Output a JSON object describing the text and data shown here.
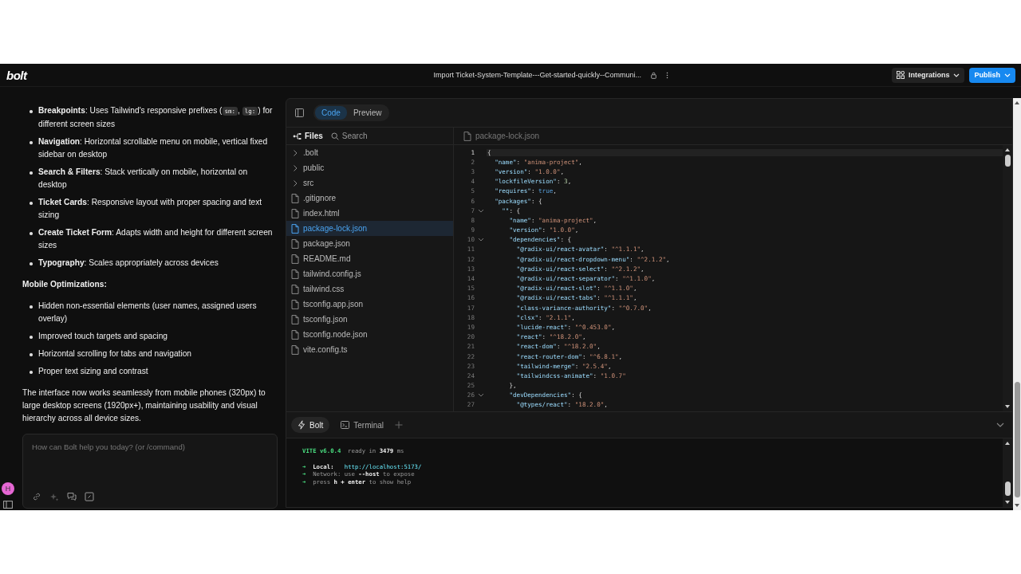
{
  "header": {
    "logo": "bolt",
    "title": "Import Ticket-System-Template---Get-started-quickly--Communi...",
    "buttons": [
      {
        "label": "Integrations",
        "kind": "secondary"
      },
      {
        "label": "Publish",
        "kind": "primary"
      }
    ]
  },
  "chat": {
    "sections": [
      {
        "kind": "list",
        "items": [
          [
            {
              "kind": "text",
              "text": "**Breakpoints**: Uses Tailwind's responsive prefixes ("
            },
            {
              "kind": "code",
              "text": "sm:"
            },
            {
              "kind": "text",
              "text": ", "
            },
            {
              "kind": "code",
              "text": "lg:"
            },
            {
              "kind": "text",
              "text": ") for different screen sizes"
            }
          ],
          [
            {
              "kind": "text",
              "text": "**Navigation**: Horizontal scrollable menu on mobile, vertical fixed sidebar on desktop"
            }
          ],
          [
            {
              "kind": "text",
              "text": "**Search & Filters**: Stack vertically on mobile, horizontal on desktop"
            }
          ],
          [
            {
              "kind": "text",
              "text": "**Ticket Cards**: Responsive layout with proper spacing and text sizing"
            }
          ],
          [
            {
              "kind": "text",
              "text": "**Create Ticket Form**: Adapts width and height for different screen sizes"
            }
          ],
          [
            {
              "kind": "text",
              "text": "**Typography**: Scales appropriately across devices"
            }
          ]
        ]
      },
      {
        "kind": "heading",
        "text": "Mobile Optimizations:"
      },
      {
        "kind": "list",
        "items": [
          [
            {
              "kind": "text",
              "text": "Hidden non-essential elements (user names, assigned users overlay)"
            }
          ],
          [
            {
              "kind": "text",
              "text": "Improved touch targets and spacing"
            }
          ],
          [
            {
              "kind": "text",
              "text": "Horizontal scrolling for tabs and navigation"
            }
          ],
          [
            {
              "kind": "text",
              "text": "Proper text sizing and contrast"
            }
          ]
        ]
      },
      {
        "kind": "paragraph",
        "text": "The interface now works seamlessly from mobile phones (320px) to large desktop screens (1920px+), maintaining usability and visual hierarchy across all device sizes."
      }
    ],
    "input": {
      "placeholder": "How can Bolt help you today? (or /command)"
    },
    "avatar": "H"
  },
  "view_tabs": [
    {
      "label": "Code",
      "selected": true
    },
    {
      "label": "Preview",
      "selected": false
    }
  ],
  "file_panel": {
    "tabs": [
      {
        "label": "Files",
        "kind": "files",
        "selected": true
      },
      {
        "label": "Search",
        "kind": "search",
        "selected": false
      }
    ],
    "files": [
      {
        "name": ".bolt",
        "kind": "folder",
        "expanded": false,
        "selected": false
      },
      {
        "name": "public",
        "kind": "folder",
        "expanded": false,
        "selected": false
      },
      {
        "name": "src",
        "kind": "folder",
        "expanded": false,
        "selected": false
      },
      {
        "name": ".gitignore",
        "kind": "file",
        "selected": false
      },
      {
        "name": "index.html",
        "kind": "file",
        "selected": false
      },
      {
        "name": "package-lock.json",
        "kind": "file",
        "selected": true
      },
      {
        "name": "package.json",
        "kind": "file",
        "selected": false
      },
      {
        "name": "README.md",
        "kind": "file",
        "selected": false
      },
      {
        "name": "tailwind.config.js",
        "kind": "file",
        "selected": false
      },
      {
        "name": "tailwind.css",
        "kind": "file",
        "selected": false
      },
      {
        "name": "tsconfig.app.json",
        "kind": "file",
        "selected": false
      },
      {
        "name": "tsconfig.json",
        "kind": "file",
        "selected": false
      },
      {
        "name": "tsconfig.node.json",
        "kind": "file",
        "selected": false
      },
      {
        "name": "vite.config.ts",
        "kind": "file",
        "selected": false
      }
    ]
  },
  "editor": {
    "tab": "package-lock.json",
    "lines": [
      {
        "number": "1",
        "text": "{",
        "fold": false,
        "selected": true
      },
      {
        "number": "2",
        "text": "  \"name\": \"anima-project\",",
        "fold": false,
        "selected": false
      },
      {
        "number": "3",
        "text": "  \"version\": \"1.0.0\",",
        "fold": false,
        "selected": false
      },
      {
        "number": "4",
        "text": "  \"lockfileVersion\": 3,",
        "fold": false,
        "selected": false
      },
      {
        "number": "5",
        "text": "  \"requires\": true,",
        "fold": false,
        "selected": false
      },
      {
        "number": "6",
        "text": "  \"packages\": {",
        "fold": false,
        "selected": false
      },
      {
        "number": "7",
        "text": "    \"\": {",
        "fold": true,
        "selected": false
      },
      {
        "number": "8",
        "text": "      \"name\": \"anima-project\",",
        "fold": false,
        "selected": false
      },
      {
        "number": "9",
        "text": "      \"version\": \"1.0.0\",",
        "fold": false,
        "selected": false
      },
      {
        "number": "10",
        "text": "      \"dependencies\": {",
        "fold": true,
        "selected": false
      },
      {
        "number": "11",
        "text": "        \"@radix-ui/react-avatar\": \"^1.1.1\",",
        "fold": false,
        "selected": false
      },
      {
        "number": "12",
        "text": "        \"@radix-ui/react-dropdown-menu\": \"^2.1.2\",",
        "fold": false,
        "selected": false
      },
      {
        "number": "13",
        "text": "        \"@radix-ui/react-select\": \"^2.1.2\",",
        "fold": false,
        "selected": false
      },
      {
        "number": "14",
        "text": "        \"@radix-ui/react-separator\": \"^1.1.0\",",
        "fold": false,
        "selected": false
      },
      {
        "number": "15",
        "text": "        \"@radix-ui/react-slot\": \"^1.1.0\",",
        "fold": false,
        "selected": false
      },
      {
        "number": "16",
        "text": "        \"@radix-ui/react-tabs\": \"^1.1.1\",",
        "fold": false,
        "selected": false
      },
      {
        "number": "17",
        "text": "        \"class-variance-authority\": \"^0.7.0\",",
        "fold": false,
        "selected": false
      },
      {
        "number": "18",
        "text": "        \"clsx\": \"2.1.1\",",
        "fold": false,
        "selected": false
      },
      {
        "number": "19",
        "text": "        \"lucide-react\": \"^0.453.0\",",
        "fold": false,
        "selected": false
      },
      {
        "number": "20",
        "text": "        \"react\": \"^18.2.0\",",
        "fold": false,
        "selected": false
      },
      {
        "number": "21",
        "text": "        \"react-dom\": \"^18.2.0\",",
        "fold": false,
        "selected": false
      },
      {
        "number": "22",
        "text": "        \"react-router-dom\": \"^6.8.1\",",
        "fold": false,
        "selected": false
      },
      {
        "number": "23",
        "text": "        \"tailwind-merge\": \"2.5.4\",",
        "fold": false,
        "selected": false
      },
      {
        "number": "24",
        "text": "        \"tailwindcss-animate\": \"1.0.7\"",
        "fold": false,
        "selected": false
      },
      {
        "number": "25",
        "text": "      },",
        "fold": false,
        "selected": false
      },
      {
        "number": "26",
        "text": "      \"devDependencies\": {",
        "fold": true,
        "selected": false
      },
      {
        "number": "27",
        "text": "        \"@types/react\": \"18.2.0\",",
        "fold": false,
        "selected": false
      }
    ]
  },
  "bottom_tabs": [
    {
      "label": "Bolt",
      "kind": "bolt",
      "selected": true
    },
    {
      "label": "Terminal",
      "kind": "terminal",
      "selected": false
    }
  ],
  "terminal": {
    "lines": [
      [
        {
          "kind": "green",
          "text": "VITE v6.0.4"
        },
        {
          "kind": "dim",
          "text": "  ready in "
        },
        {
          "kind": "bright",
          "text": "3479"
        },
        {
          "kind": "dim",
          "text": " ms"
        }
      ],
      [
        {
          "kind": "arrow",
          "text": "➜"
        },
        {
          "kind": "bright",
          "text": "  Local:   "
        },
        {
          "kind": "link",
          "text": "http://localhost:5173/"
        }
      ],
      [
        {
          "kind": "arrowdim",
          "text": "➜"
        },
        {
          "kind": "dim",
          "text": "  Network: use "
        },
        {
          "kind": "bright",
          "text": "--host"
        },
        {
          "kind": "dim",
          "text": " to expose"
        }
      ],
      [
        {
          "kind": "arrowdim",
          "text": "➜"
        },
        {
          "kind": "dim",
          "text": "  press "
        },
        {
          "kind": "bright",
          "text": "h + enter"
        },
        {
          "kind": "dim",
          "text": " to show help"
        }
      ]
    ]
  }
}
